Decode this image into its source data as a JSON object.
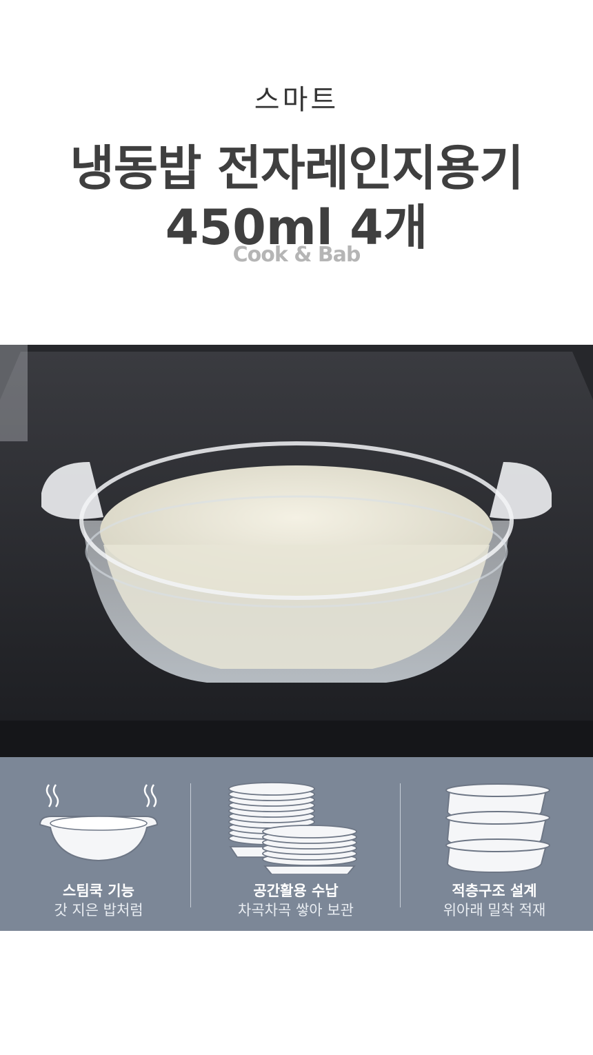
{
  "header": {
    "eyebrow": "스마트",
    "title_line1": "냉동밥 전자레인지용기",
    "title_line2": "450ml  4개",
    "brand": "Cook & Bab"
  },
  "features": [
    {
      "icon": "steam-bowl-icon",
      "title": "스팀쿡 기능",
      "subtitle": "갓 지은 밥처럼"
    },
    {
      "icon": "stacked-bowls-icon",
      "title": "공간활용 수납",
      "subtitle": "차곡차곡 쌓아 보관"
    },
    {
      "icon": "layered-containers-icon",
      "title": "적층구조 설계",
      "subtitle": "위아래 밀착 적재"
    }
  ],
  "colors": {
    "feature_band": "#7c8797",
    "title_text": "#3f3f3f",
    "brand_text": "#b5b5b5"
  }
}
